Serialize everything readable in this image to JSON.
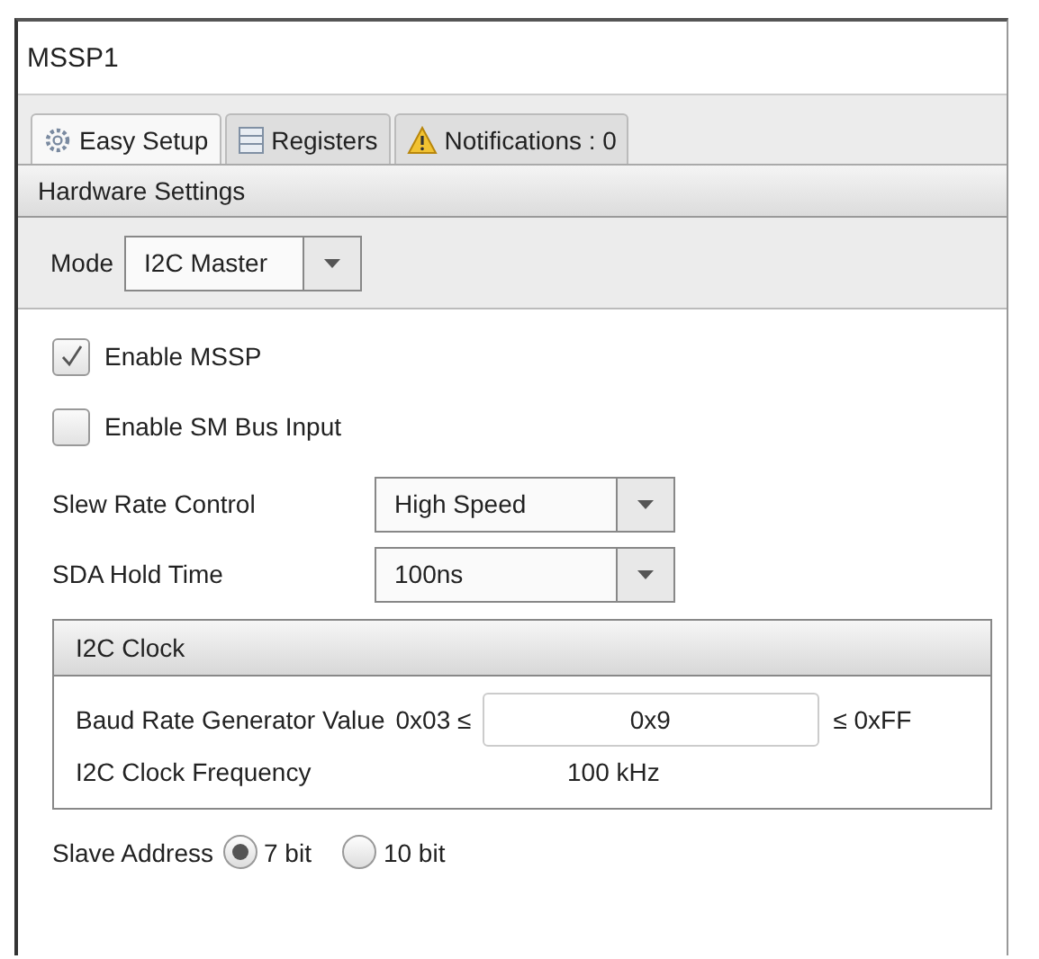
{
  "window": {
    "title": "MSSP1"
  },
  "tabs": [
    {
      "label": "Easy Setup",
      "kind": "gear",
      "selected": true
    },
    {
      "label": "Registers",
      "kind": "list",
      "selected": false
    },
    {
      "label": "Notifications : 0",
      "kind": "warning",
      "selected": false
    }
  ],
  "section": {
    "title": "Hardware Settings"
  },
  "mode": {
    "label": "Mode",
    "value": "I2C Master"
  },
  "checkboxes": [
    {
      "label": "Enable MSSP",
      "checked": true
    },
    {
      "label": "Enable SM Bus Input",
      "checked": false
    }
  ],
  "dropdowns": [
    {
      "label": "Slew Rate Control",
      "value": "High Speed"
    },
    {
      "label": "SDA Hold Time",
      "value": "100ns"
    }
  ],
  "clock": {
    "title": "I2C Clock",
    "baud_label": "Baud Rate Generator Value",
    "min": "0x03 ≤",
    "value": "0x9",
    "max": "≤ 0xFF",
    "freq_label": "I2C Clock Frequency",
    "freq_value": "100 kHz"
  },
  "slave_address": {
    "label": "Slave Address",
    "options": [
      {
        "label": "7 bit",
        "selected": true
      },
      {
        "label": "10 bit",
        "selected": false
      }
    ]
  }
}
